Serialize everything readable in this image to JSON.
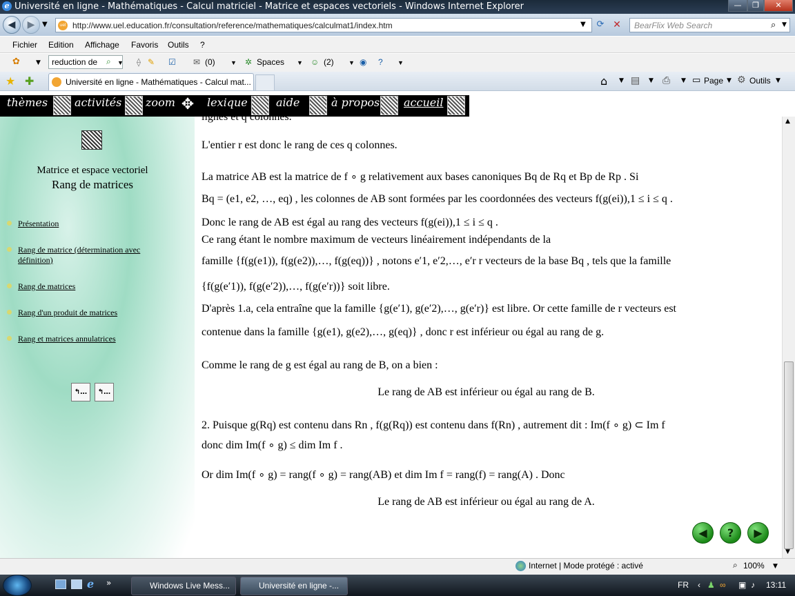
{
  "window": {
    "title": "Université en ligne - Mathématiques - Calcul matriciel - Matrice et espaces vectoriels - Windows Internet Explorer"
  },
  "address": {
    "url": "http://www.uel.education.fr/consultation/reference/mathematiques/calculmat1/index.htm"
  },
  "search": {
    "placeholder": "BearFlix Web Search"
  },
  "menu": [
    "Fichier",
    "Edition",
    "Affichage",
    "Favoris",
    "Outils",
    "?"
  ],
  "toolbar": {
    "search_value": "reduction de",
    "mail_count": "(0)",
    "spaces": "Spaces",
    "msn_count": "(2)"
  },
  "tab": {
    "label": "Université en ligne - Mathématiques - Calcul mat..."
  },
  "command": {
    "page": "Page",
    "tools": "Outils"
  },
  "site_nav": [
    "thèmes",
    "activités",
    "zoom",
    "lexique",
    "aide",
    "à propos",
    "accueil"
  ],
  "sidebar": {
    "title1": "Matrice et espace vectoriel",
    "title2": "Rang de matrices",
    "items": [
      "Présentation",
      "Rang de matrice (détermination avec définition)",
      "Rang de matrices",
      "Rang d'un produit de matrices",
      "Rang et matrices annulatrices"
    ]
  },
  "content": {
    "l0": "lignes et q colonnes.",
    "l1": "L'entier r est donc le rang de ces q colonnes.",
    "l2": "La matrice AB est la matrice de  f ∘ g  relativement aux bases canoniques  Bq  de  Rq  et  Bp  de  Rp . Si",
    "l3": "Bq = (e1, e2, …, eq) , les colonnes de AB sont formées par les coordonnées des vecteurs  f(g(ei)),1 ≤ i ≤ q .",
    "l4": "Donc le rang de AB est égal au rang des vecteurs  f(g(ei)),1 ≤ i ≤ q .",
    "l5": "Ce rang étant le nombre maximum de vecteurs linéairement indépendants de la",
    "l6": "famille {f(g(e1)), f(g(e2)),…, f(g(eq))} , notons  e′1, e′2,…, e′r  r vecteurs de la base  Bq , tels que la famille",
    "l7": "{f(g(e′1)), f(g(e′2)),…, f(g(e′r))}  soit libre.",
    "l8": "D'après 1.a, cela entraîne que la famille {g(e′1), g(e′2),…, g(e′r)}  est libre. Or cette famille de r vecteurs est",
    "l9": "contenue dans la famille {g(e1), g(e2),…, g(eq)} , donc r est inférieur ou égal au rang de g.",
    "l10": "Comme le rang de g est égal au rang de B, on a bien :",
    "l11": "Le rang de AB est inférieur ou égal au rang de B.",
    "l12": "2. Puisque  g(Rq)  est contenu dans  Rn ,  f(g(Rq))  est contenu dans  f(Rn) , autrement dit : Im(f ∘ g) ⊂ Im f",
    "l13": "donc  dim Im(f ∘ g) ≤ dim Im f .",
    "l14": "Or  dim Im(f ∘ g) = rang(f ∘ g) = rang(AB)  et  dim Im f = rang(f) = rang(A) . Donc",
    "l15": "Le rang de AB est inférieur ou égal au rang de A."
  },
  "status": {
    "text": "Internet | Mode protégé : activé",
    "zoom": "100%"
  },
  "taskbar": {
    "tasks": [
      "Windows Live Mess...",
      "Université en ligne -..."
    ],
    "lang": "FR",
    "time": "13:11"
  }
}
